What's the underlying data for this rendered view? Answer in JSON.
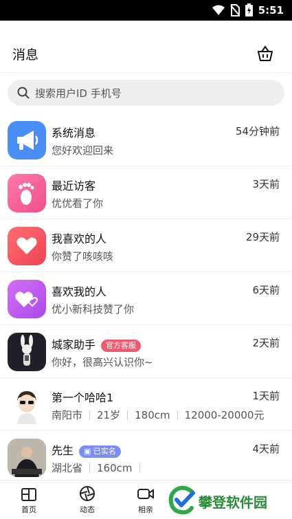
{
  "status_bar": {
    "time": "5:51",
    "icons": [
      "wifi-icon",
      "no-sim-icon",
      "battery-charging-icon"
    ]
  },
  "header": {
    "title": "消息",
    "action_icon": "basket-icon"
  },
  "search": {
    "placeholder": "搜索用户ID 手机号"
  },
  "messages": [
    {
      "name": "系统消息",
      "time": "54分钟前",
      "preview": "您好欢迎回来",
      "icon": "megaphone-icon",
      "color": "#4a8ef5"
    },
    {
      "name": "最近访客",
      "time": "3天前",
      "preview": "优优看了你",
      "icon": "footprint-icon",
      "color": "#f3609a"
    },
    {
      "name": "我喜欢的人",
      "time": "29天前",
      "preview": "你赞了咳咳咳",
      "icon": "heart-icon",
      "color": "#f4575f"
    },
    {
      "name": "喜欢我的人",
      "time": "6天前",
      "preview": "优小新科技赞了你",
      "icon": "hearts-icon",
      "color": "#c15cf0"
    },
    {
      "name": "城家助手",
      "tag": "官方客服",
      "time": "2天前",
      "preview": "你好，很高兴认识你~",
      "icon": "rabbit-avatar"
    },
    {
      "name": "第一个哈哈1",
      "time": "1天前",
      "meta": [
        "南阳市",
        "21岁",
        "180cm",
        "12000-20000元"
      ],
      "icon": "user-avatar"
    },
    {
      "name": "先生",
      "tag": "已实名",
      "time": "4天前",
      "meta": [
        "湖北省",
        "160cm"
      ],
      "icon": "user-photo-avatar"
    }
  ],
  "bottom_nav": [
    {
      "label": "首页",
      "icon": "home-icon"
    },
    {
      "label": "动态",
      "icon": "aperture-icon"
    },
    {
      "label": "相亲",
      "icon": "video-icon"
    }
  ],
  "watermark": {
    "text": "攀登软件园"
  }
}
